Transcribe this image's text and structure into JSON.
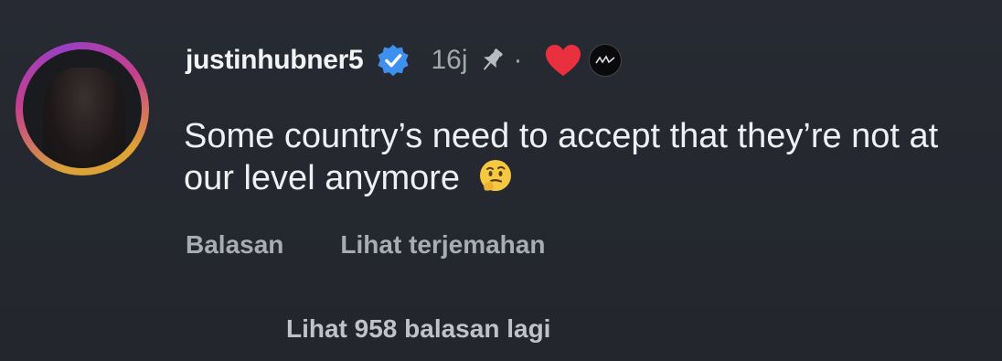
{
  "comment": {
    "username": "justinhubner5",
    "timestamp": "16j",
    "separator": "·",
    "text": "Some country’s need to accept that they’re not at our level anymore",
    "emoji_icon": "thinking-face-icon",
    "verified_icon": "verified-badge-icon",
    "pin_icon": "pin-icon",
    "liked_icon": "heart-icon",
    "badge_icon": "creator-badge-icon",
    "actions": {
      "reply_label": "Balasan",
      "translate_label": "Lihat terjemahan"
    },
    "more_replies_label": "Lihat 958 balasan lagi"
  },
  "colors": {
    "background": "#252830",
    "verified": "#3f8ff0",
    "heart": "#e8303f"
  }
}
